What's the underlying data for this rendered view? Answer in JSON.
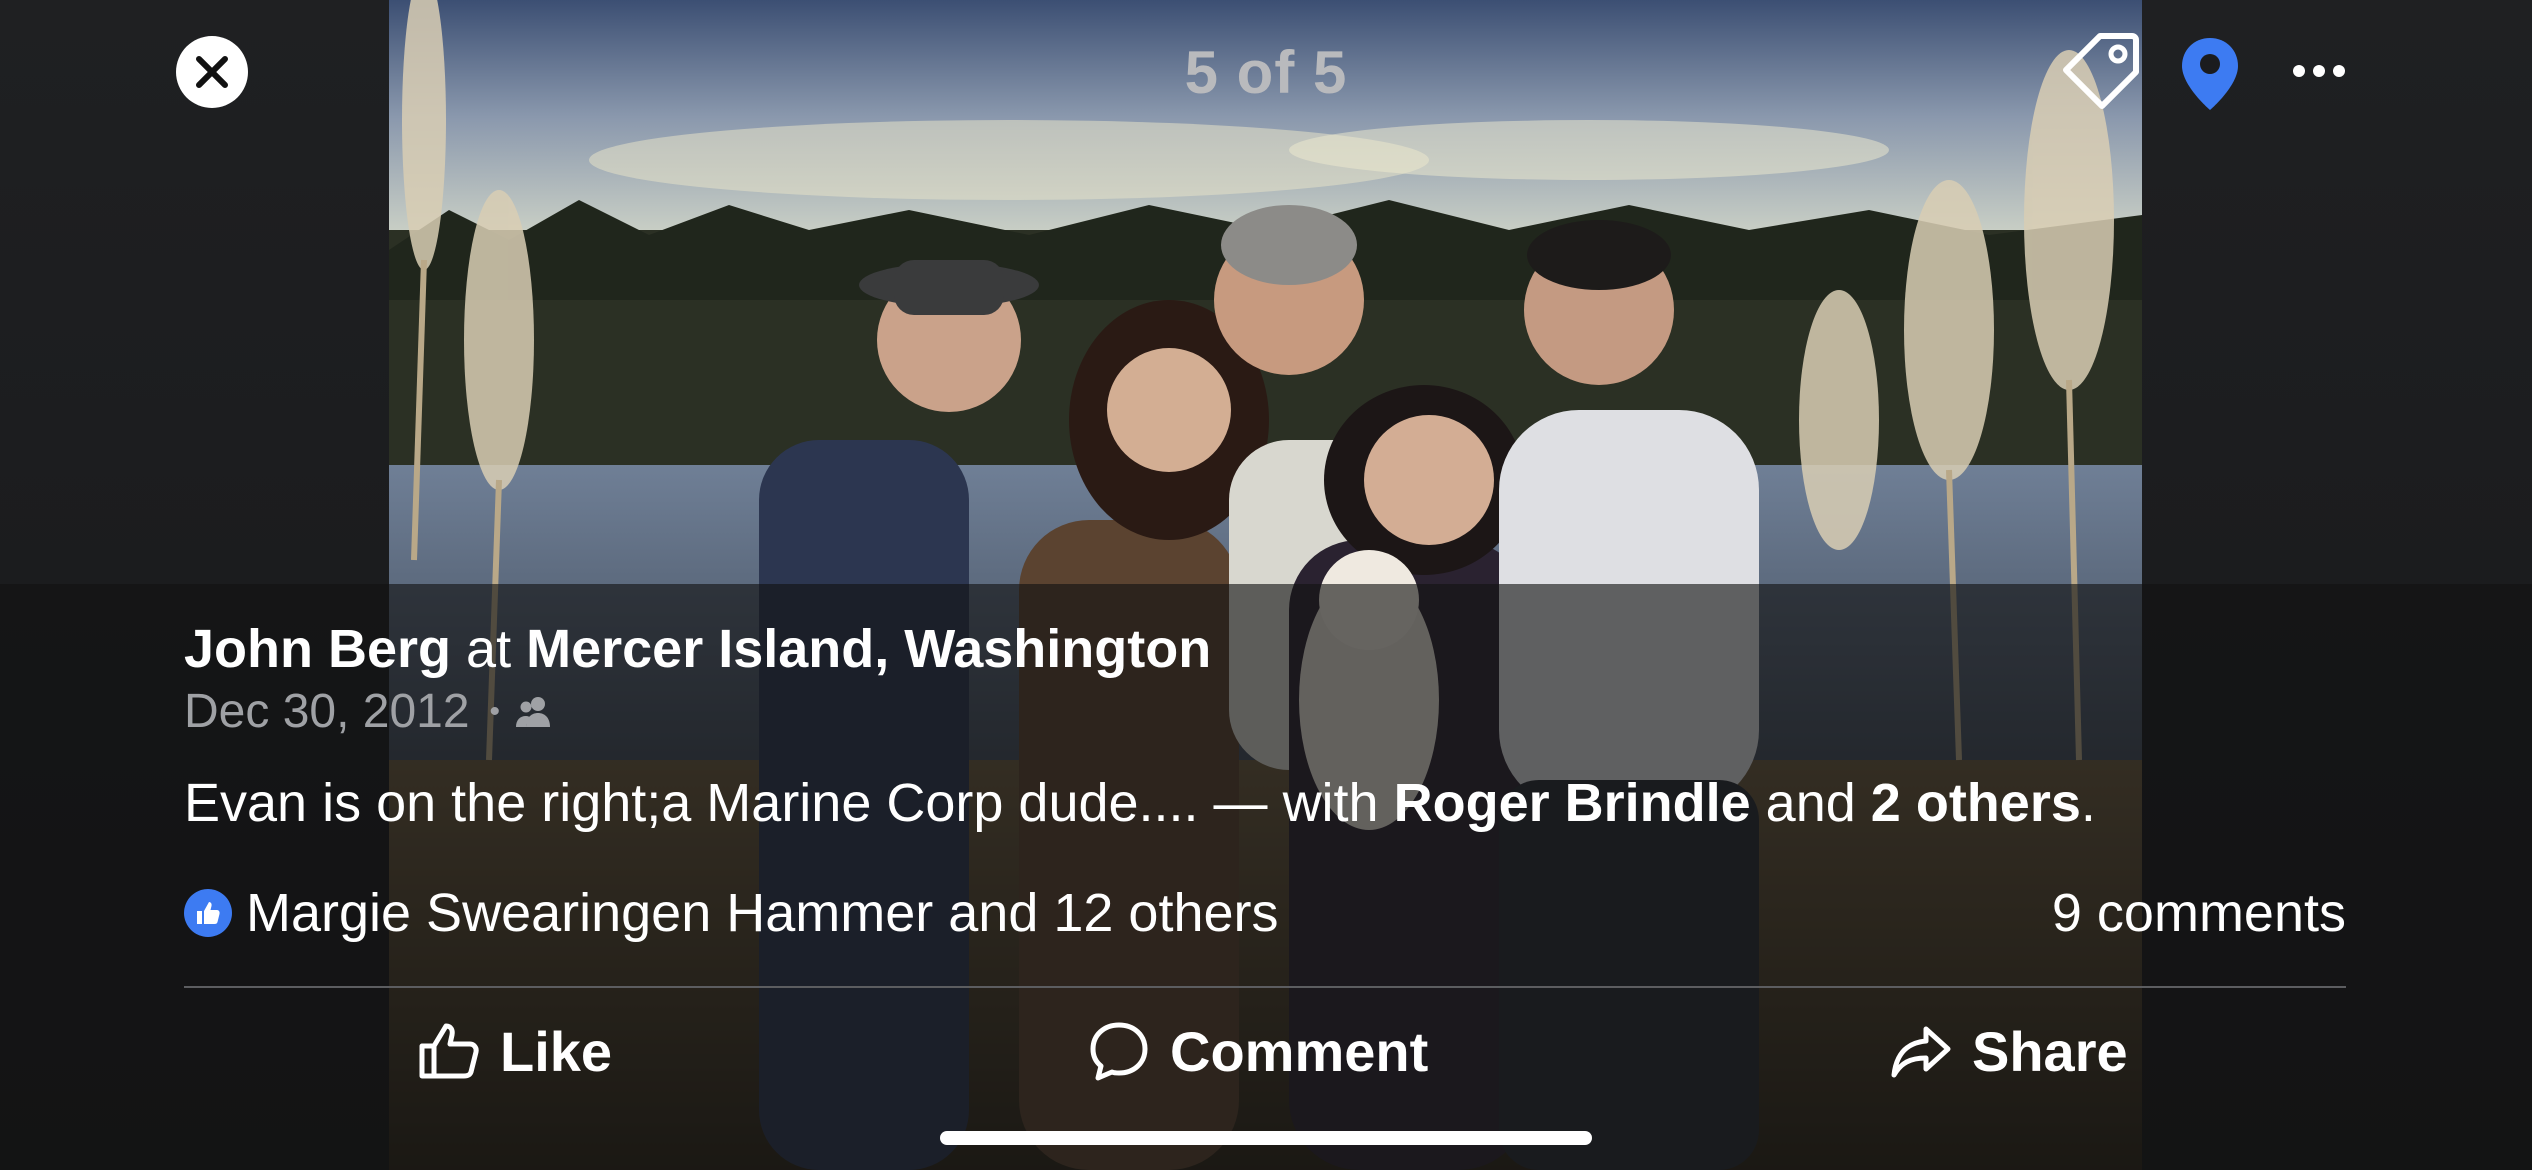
{
  "header": {
    "counter": "5 of 5",
    "icons": [
      "close-icon",
      "tag-icon",
      "location-pin-icon",
      "more-icon"
    ]
  },
  "post": {
    "author": "John Berg",
    "at_text": "at",
    "location": "Mercer Island, Washington",
    "date": "Dec 30, 2012",
    "separator": "•",
    "audience_icon": "friends-icon",
    "caption": {
      "text": "Evan is on the right;a Marine Corp dude.... — with",
      "tagged_person": "Roger Brindle",
      "and_text": "and",
      "others": "2 others",
      "end": "."
    }
  },
  "engagement": {
    "reactions_text": "Margie Swearingen Hammer and 12 others",
    "comments_text": "9 comments"
  },
  "actions": {
    "like": "Like",
    "comment": "Comment",
    "share": "Share"
  },
  "colors": {
    "accent_blue": "#3d7bf2",
    "background": "#1b1c1e",
    "muted_text": "#9fa1a5"
  }
}
